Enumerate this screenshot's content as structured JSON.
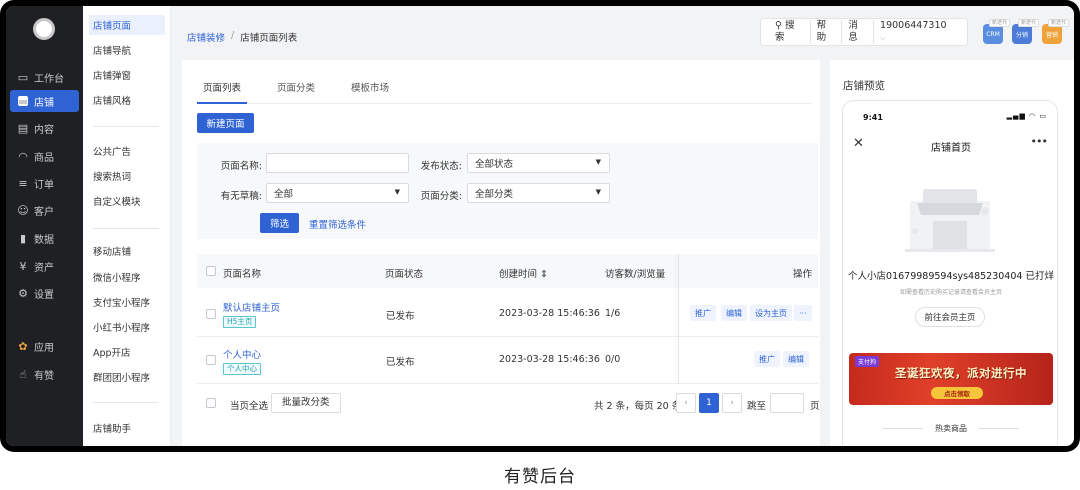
{
  "caption": "有赞后台",
  "nav_main": [
    {
      "label": "工作台",
      "icon": "monitor-icon"
    },
    {
      "label": "店铺",
      "icon": "store-icon",
      "active": true
    },
    {
      "label": "内容",
      "icon": "document-icon"
    },
    {
      "label": "商品",
      "icon": "bag-icon"
    },
    {
      "label": "订单",
      "icon": "list-icon"
    },
    {
      "label": "客户",
      "icon": "user-icon"
    },
    {
      "label": "数据",
      "icon": "bar-chart-icon"
    },
    {
      "label": "资产",
      "icon": "yen-icon"
    },
    {
      "label": "设置",
      "icon": "gear-icon"
    },
    {
      "label": "应用",
      "icon": "apps-icon"
    },
    {
      "label": "有赞",
      "icon": "thumb-up-icon"
    }
  ],
  "nav_sub": {
    "group1": [
      "店铺页面",
      "店铺导航",
      "店铺弹窗",
      "店铺风格"
    ],
    "group2": [
      "公共广告",
      "搜索热词",
      "自定义模块"
    ],
    "group3": [
      "移动店铺",
      "微信小程序",
      "支付宝小程序",
      "小红书小程序",
      "App开店",
      "群团团小程序"
    ],
    "group4": [
      "店铺助手"
    ]
  },
  "breadcrumb": {
    "parent": "店铺装修",
    "separator": "/",
    "current": "店铺页面列表"
  },
  "topbar": {
    "search": "搜索",
    "help": "帮助",
    "messages": "消息",
    "phone": "19006447310",
    "apps": [
      {
        "name": "CRM",
        "tag": "新迭代",
        "color": "#5a8de0"
      },
      {
        "name": "分销",
        "tag": "新迭代",
        "color": "#4c7bd8"
      },
      {
        "name": "营销",
        "tag": "新迭代",
        "color": "#f0a23a"
      }
    ]
  },
  "tabs": [
    "页面列表",
    "页面分类",
    "模板市场"
  ],
  "new_page_button": "新建页面",
  "filters": {
    "page_name_label": "页面名称:",
    "page_name_value": "",
    "publish_status_label": "发布状态:",
    "publish_status_value": "全部状态",
    "draft_label": "有无草稿:",
    "draft_value": "全部",
    "category_label": "页面分类:",
    "category_value": "全部分类",
    "filter_button": "筛选",
    "reset_link": "重置筛选条件"
  },
  "table": {
    "columns": [
      "页面名称",
      "页面状态",
      "创建时间 ⇕",
      "访客数/浏览量",
      "操作"
    ],
    "rows": [
      {
        "name": "默认店铺主页",
        "tag": "H5主页",
        "status": "已发布",
        "created": "2023-03-28 15:46:36",
        "visits": "1/6",
        "actions": [
          "推广",
          "编辑",
          "设为主页",
          "···"
        ]
      },
      {
        "name": "个人中心",
        "tag": "个人中心",
        "status": "已发布",
        "created": "2023-03-28 15:46:36",
        "visits": "0/0",
        "actions": [
          "推广",
          "编辑"
        ]
      }
    ]
  },
  "footer": {
    "select_all": "当页全选",
    "batch_button": "批量改分类",
    "summary": "共 2 条，每页 20 条",
    "current_page": "1",
    "jump_label": "跳至",
    "page_unit": "页"
  },
  "preview": {
    "title": "店铺预览",
    "time": "9:41",
    "signal": "▂▄▆ ◠ ▭",
    "page_title": "店铺首页",
    "shop_name": "个人小店01679989594sys485230404 已打烊",
    "shop_sub": "如需查看历史购买记录请查看会员主页",
    "member_button": "前往会员主页",
    "banner_tag": "支付狗",
    "banner_title": "圣诞狂欢夜，派对进行中",
    "banner_button": "点击领取",
    "hot_title": "热卖商品"
  }
}
